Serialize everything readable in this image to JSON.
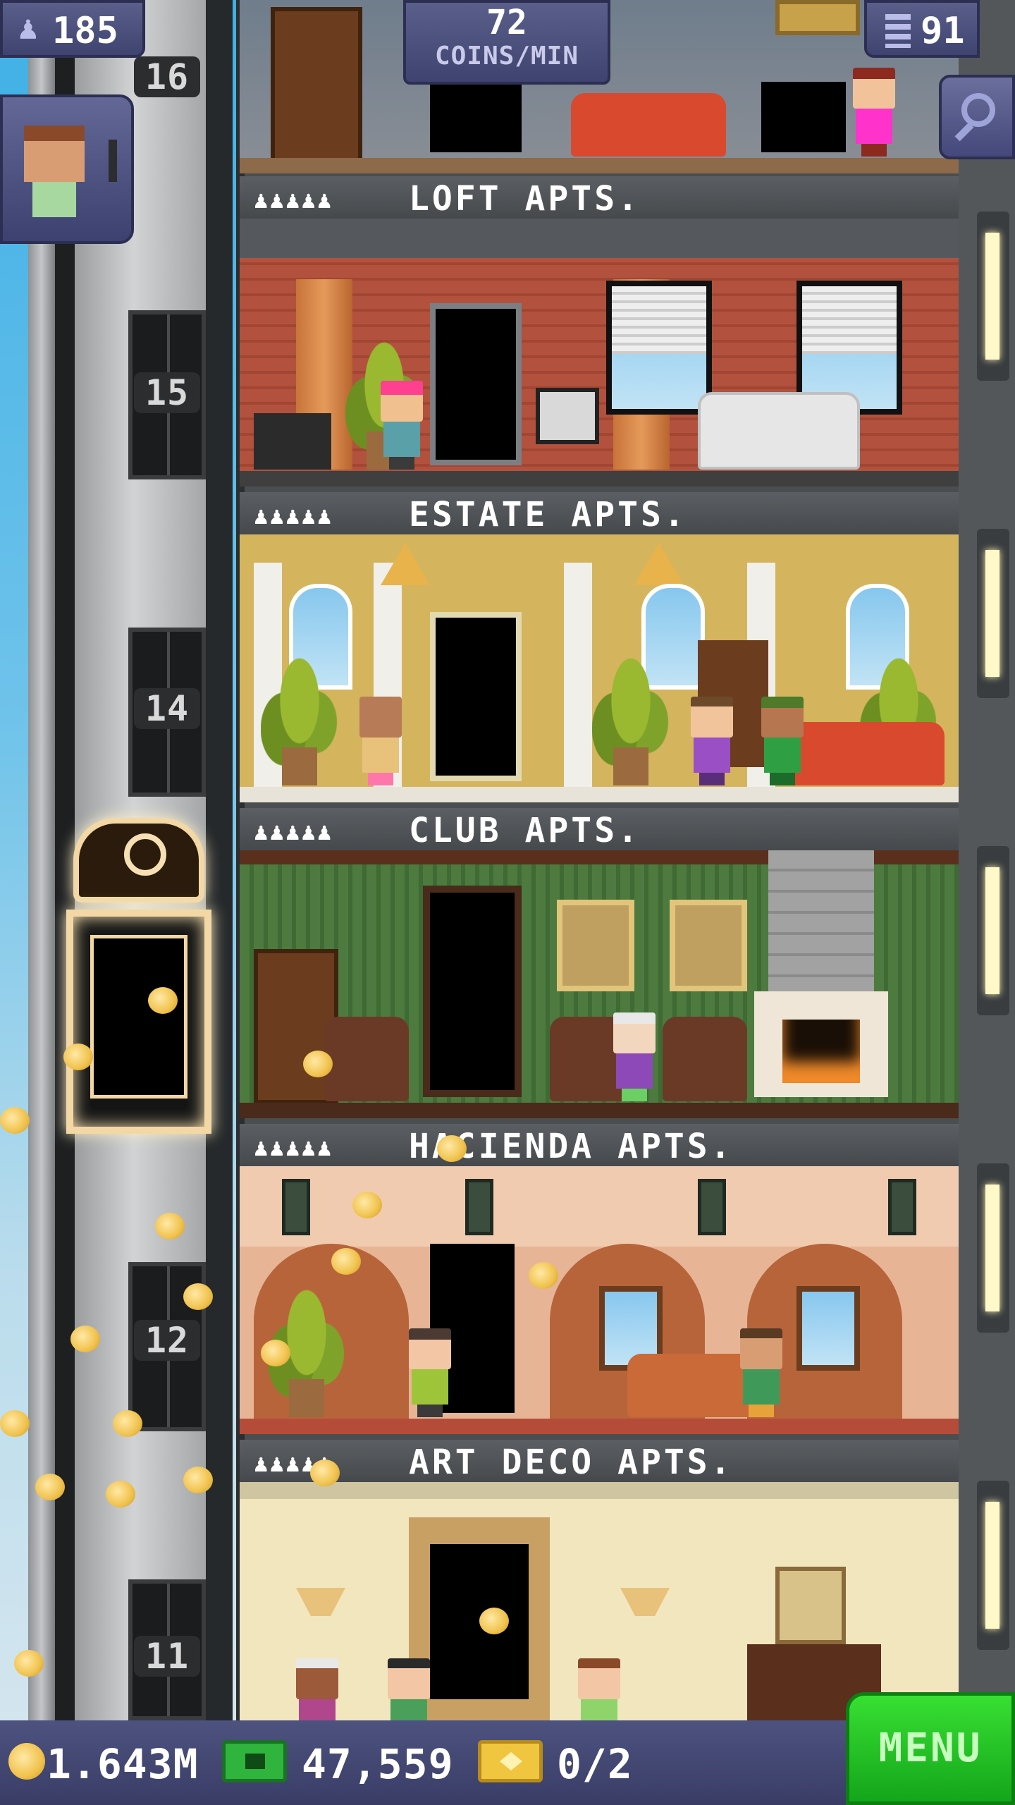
{
  "hud": {
    "population": "185",
    "coins_rate": "72",
    "coins_rate_unit": "COINS/MIN",
    "floors": "91"
  },
  "elevator": {
    "floor_labels": [
      "16",
      "15",
      "14",
      "12",
      "11"
    ]
  },
  "floors": [
    {
      "sign": "LOFT APTS.",
      "icons": "♟♟♟♟♟"
    },
    {
      "sign": "ESTATE APTS.",
      "icons": "♟♟♟♟♟"
    },
    {
      "sign": "CLUB APTS.",
      "icons": "♟♟♟♟♟"
    },
    {
      "sign": "HACIENDA APTS.",
      "icons": "♟♟♟♟♟"
    },
    {
      "sign": "ART DECO APTS.",
      "icons": "♟♟♟♟♟"
    }
  ],
  "bottom_bar": {
    "coins": "1.643M",
    "bux": "47,559",
    "vip": "0/2",
    "menu_label": "MENU"
  },
  "colors": {
    "hud_bg": "#4a4f7c",
    "menu_green": "#22c322",
    "coin_gold": "#f0c24c"
  },
  "icons": [
    "person-icon",
    "floors-icon",
    "search-icon",
    "coin-icon",
    "bux-icon",
    "vip-ticket-icon"
  ]
}
